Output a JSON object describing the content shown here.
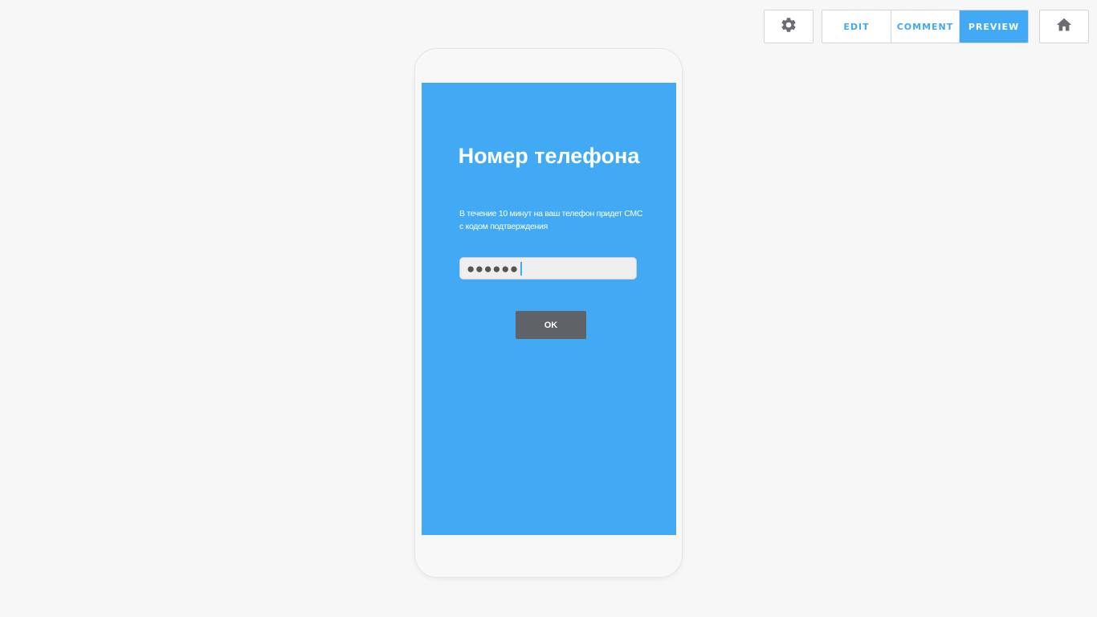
{
  "toolbar": {
    "settings_icon": "gear-icon",
    "modes": {
      "edit": "EDIT",
      "comment": "COMMENT",
      "preview": "PREVIEW",
      "active": "preview"
    },
    "home_icon": "home-icon"
  },
  "screen": {
    "title": "Номер телефона",
    "description": "В течение 10 минут на ваш телефон придет СМС с кодом подтверждения",
    "code_input": {
      "value": "●●●●●●"
    },
    "ok_button": "OK"
  },
  "colors": {
    "accent": "#42a9f4",
    "background": "#f7f7f7",
    "button_dark": "#5f6368"
  }
}
